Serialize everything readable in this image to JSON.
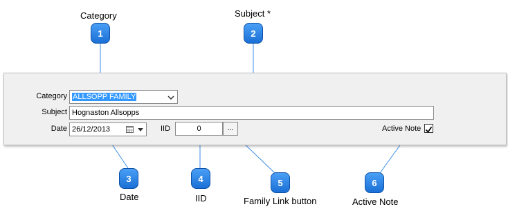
{
  "callouts": [
    {
      "number": "1",
      "label": "Category"
    },
    {
      "number": "2",
      "label": "Subject *"
    },
    {
      "number": "3",
      "label": "Date"
    },
    {
      "number": "4",
      "label": "IID"
    },
    {
      "number": "5",
      "label": "Family Link button"
    },
    {
      "number": "6",
      "label": "Active Note"
    }
  ],
  "form": {
    "category_label": "Category",
    "category_value": "ALLSOPP FAMILY",
    "subject_label": "Subject",
    "subject_value": "Hognaston Allsopps",
    "date_label": "Date",
    "date_value": "26/12/2013",
    "iid_label": "IID",
    "iid_value": "0",
    "family_link_button": "...",
    "active_note_label": "Active Note",
    "active_note_checked": true
  },
  "icons": {
    "calendar": "calendar-icon",
    "dropdown": "chevron-down-icon",
    "checkmark": "checkmark-icon"
  },
  "colors": {
    "badge": "#1a6fd6",
    "selection": "#3399ff",
    "callout_line": "#3a8ee6"
  }
}
